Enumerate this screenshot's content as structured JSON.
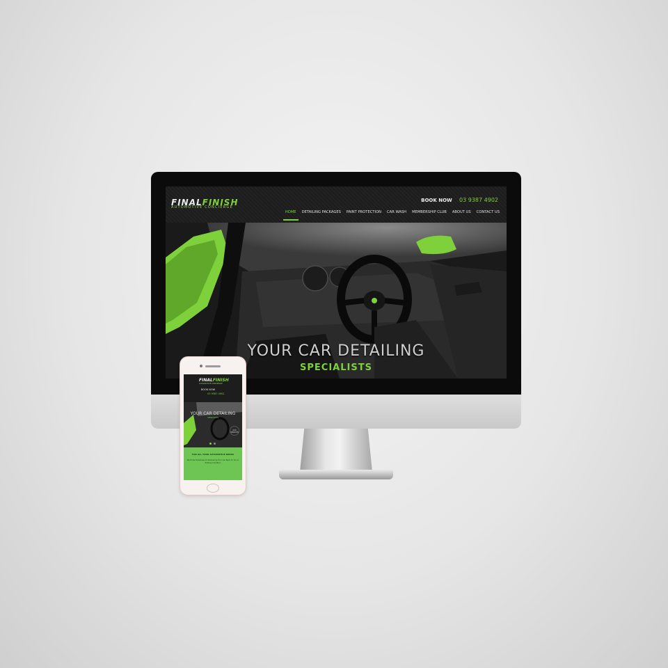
{
  "site": {
    "logo_part1": "FINAL",
    "logo_part2": "FINISH",
    "tagline": "AUTOMOTIVE CONCIERGE",
    "book_label": "BOOK NOW",
    "phone": "03 9387 4902",
    "nav": [
      "HOME",
      "DETAILING PACKAGES",
      "PAINT PROTECTION",
      "CAR WASH",
      "MEMBERSHIP CLUB",
      "ABOUT US",
      "CONTACT US"
    ],
    "active_nav": "HOME",
    "hero_line1": "YOUR CAR DETAILING",
    "hero_line2": "SPECIALISTS"
  },
  "mobile": {
    "logo_part1": "FINAL",
    "logo_part2": "FINISH",
    "tagline": "AUTOMOTIVE CONCIERGE",
    "book_label": "BOOK NOW",
    "phone": "03 9387 4902",
    "hero_line": "YOUR CAR DETAILING",
    "hero_sub": "SPECIALISTS",
    "badge": "OUR SERVICES",
    "green_title": "FOR ALL YOUR AUTOMOTIVE NEEDS",
    "green_body": "We Pride Ourselves On Delivering Your Car Back To You In Pristine Condition"
  },
  "colors": {
    "accent": "#7fd13b",
    "green_panel": "#6ec553",
    "dark": "#111111"
  },
  "icons": {
    "car_interior": "hero-image",
    "home_button": "home-button-icon"
  }
}
